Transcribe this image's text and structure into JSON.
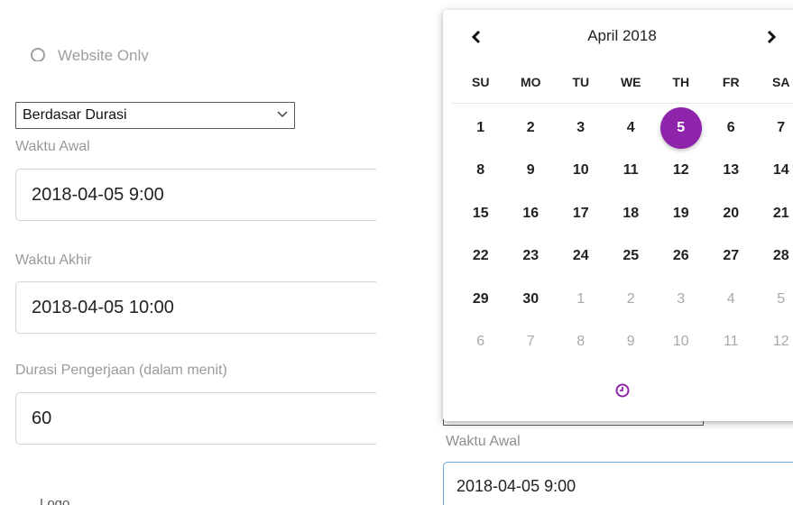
{
  "form": {
    "radio_label": "Website Only",
    "mode_select": {
      "value": "Berdasar Durasi"
    },
    "start": {
      "label": "Waktu Awal",
      "value": "2018-04-05 9:00"
    },
    "end": {
      "label": "Waktu Akhir",
      "value": "2018-04-05 10:00"
    },
    "duration": {
      "label": "Durasi Pengerjaan (dalam menit)",
      "value": "60"
    },
    "bottom_text": "Logo"
  },
  "right_form": {
    "start_label": "Waktu Awal",
    "start_value": "2018-04-05 9:00"
  },
  "calendar": {
    "title": "April 2018",
    "weekdays": [
      "SU",
      "MO",
      "TU",
      "WE",
      "TH",
      "FR",
      "SA"
    ],
    "weeks": [
      [
        "1",
        "2",
        "3",
        "4",
        "5",
        "6",
        "7"
      ],
      [
        "8",
        "9",
        "10",
        "11",
        "12",
        "13",
        "14"
      ],
      [
        "15",
        "16",
        "17",
        "18",
        "19",
        "20",
        "21"
      ],
      [
        "22",
        "23",
        "24",
        "25",
        "26",
        "27",
        "28"
      ],
      [
        "29",
        "30",
        "1",
        "2",
        "3",
        "4",
        "5"
      ],
      [
        "6",
        "7",
        "8",
        "9",
        "10",
        "11",
        "12"
      ]
    ],
    "selected_day": "5",
    "accent_color": "#8e24aa",
    "icons": {
      "prev": "chevron-left-icon",
      "next": "chevron-right-icon",
      "time": "clock-icon"
    }
  }
}
